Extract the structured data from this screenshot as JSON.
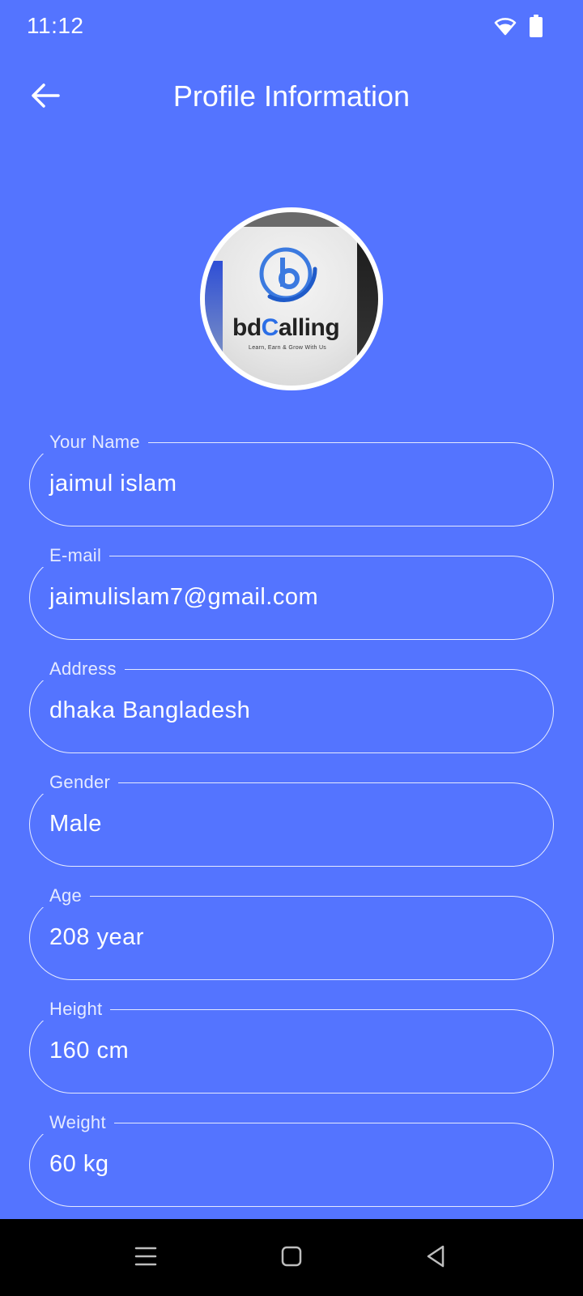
{
  "status_bar": {
    "time": "11:12"
  },
  "header": {
    "title": "Profile Information"
  },
  "avatar": {
    "brand_prefix": "bd",
    "brand_accent": "C",
    "brand_suffix": "alling",
    "tagline": "Learn, Earn & Grow With Us"
  },
  "fields": [
    {
      "label": "Your Name",
      "value": "jaimul islam"
    },
    {
      "label": "E-mail",
      "value": "jaimulislam7@gmail.com"
    },
    {
      "label": "Address",
      "value": "dhaka Bangladesh"
    },
    {
      "label": "Gender",
      "value": "Male"
    },
    {
      "label": "Age",
      "value": "208 year"
    },
    {
      "label": "Height",
      "value": "160 cm"
    },
    {
      "label": "Weight",
      "value": "60 kg"
    }
  ],
  "colors": {
    "background": "#5474ff",
    "nav_bar": "#000000",
    "text": "#ffffff"
  },
  "icons": {
    "back": "arrow-left-icon",
    "wifi": "wifi-icon",
    "battery": "battery-icon",
    "nav_recents": "menu-lines-icon",
    "nav_home": "square-icon",
    "nav_back": "triangle-back-icon"
  }
}
